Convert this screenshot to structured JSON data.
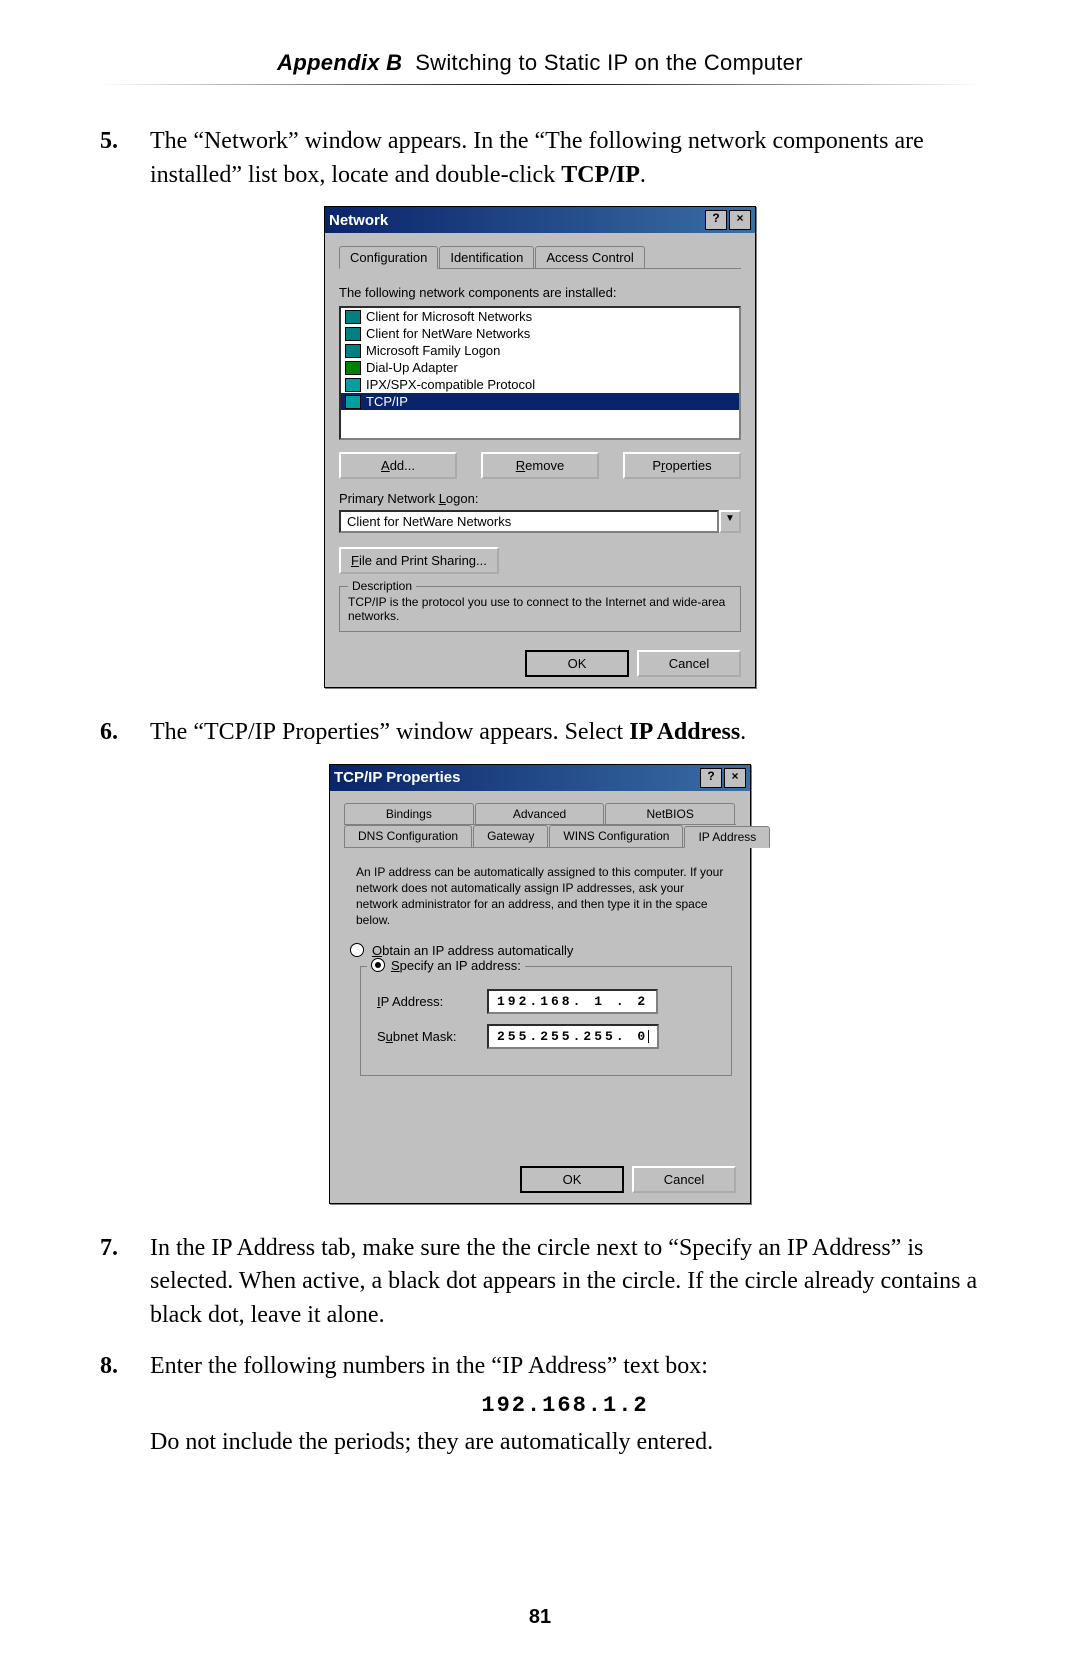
{
  "header": {
    "appendix": "Appendix B",
    "title": "Switching to Static IP on the Computer"
  },
  "page_number": "81",
  "steps": {
    "s5": {
      "num": "5.",
      "text_a": "The “Network” window appears. In the “The following network components are installed” list box, locate and double-click ",
      "bold": "TCP/IP",
      "text_b": "."
    },
    "s6": {
      "num": "6.",
      "text_a": "The “",
      "sc": "TCP/IP",
      "text_b": " Properties” window appears. Select ",
      "bold": "IP Address",
      "text_c": "."
    },
    "s7": {
      "num": "7.",
      "text": "In the IP Address tab, make sure the the circle next to “Specify an IP Address” is selected. When active, a black dot appears in the circle. If the circle already contains a black dot, leave it alone."
    },
    "s8": {
      "num": "8.",
      "text_a": "Enter the following numbers in the “",
      "sc": "IP",
      "text_b": " Address” text box:",
      "ip": "192.168.1.2",
      "text_c": "Do not include the periods; they are automatically entered."
    }
  },
  "dialog1": {
    "title": "Network",
    "help": "?",
    "close": "×",
    "tabs": {
      "a": "Configuration",
      "b": "Identification",
      "c": "Access Control"
    },
    "list_label": "The following network components are installed:",
    "items": {
      "i1": "Client for Microsoft Networks",
      "i2": "Client for NetWare Networks",
      "i3": "Microsoft Family Logon",
      "i4": "Dial-Up Adapter",
      "i5": "IPX/SPX-compatible Protocol",
      "i6": "TCP/IP"
    },
    "btn_add": "Add...",
    "add_u": "A",
    "btn_remove": "Remove",
    "rem_u": "R",
    "btn_props": "Properties",
    "pr_u": "r",
    "logon_label": "Primary Network Logon:",
    "logon_u": "L",
    "logon_sel": "Client for NetWare Networks",
    "fps": "File and Print Sharing...",
    "fps_u": "F",
    "desc_label": "Description",
    "desc": "TCP/IP is the protocol you use to connect to the Internet and wide-area networks.",
    "ok": "OK",
    "cancel": "Cancel"
  },
  "dialog2": {
    "title": "TCP/IP Properties",
    "help": "?",
    "close": "×",
    "tabs_top": {
      "a": "Bindings",
      "b": "Advanced",
      "c": "NetBIOS"
    },
    "tabs_bot": {
      "a": "DNS Configuration",
      "b": "Gateway",
      "c": "WINS Configuration",
      "d": "IP Address"
    },
    "desc": "An IP address can be automatically assigned to this computer. If your network does not automatically assign IP addresses, ask your network administrator for an address, and then type it in the space below.",
    "opt_auto": "Obtain an IP address automatically",
    "auto_u": "O",
    "opt_spec": "Specify an IP address:",
    "spec_u": "S",
    "ip_label": "IP Address:",
    "ip_u": "I",
    "ip_value": "192.168. 1 . 2",
    "mask_label": "Subnet Mask:",
    "mask_u": "u",
    "mask_value": "255.255.255. 0",
    "ok": "OK",
    "cancel": "Cancel"
  }
}
